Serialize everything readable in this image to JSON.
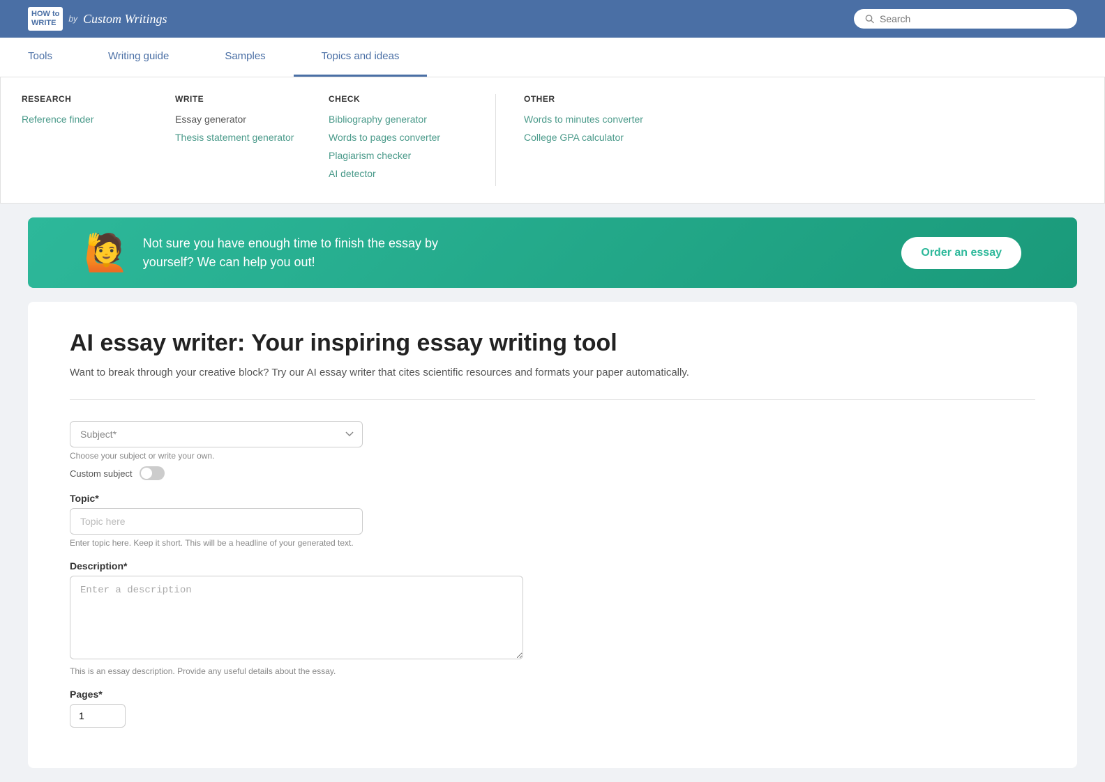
{
  "header": {
    "logo_line1": "HOW to",
    "logo_line2": "WRITE",
    "logo_by": "by",
    "logo_brand": "Custom Writings",
    "search_placeholder": "Search"
  },
  "nav": {
    "items": [
      {
        "id": "tools",
        "label": "Tools"
      },
      {
        "id": "writing-guide",
        "label": "Writing guide"
      },
      {
        "id": "samples",
        "label": "Samples"
      },
      {
        "id": "topics-ideas",
        "label": "Topics and ideas"
      }
    ]
  },
  "dropdown": {
    "research": {
      "title": "RESEARCH",
      "links": [
        {
          "label": "Reference finder",
          "href": "#"
        }
      ]
    },
    "write": {
      "title": "WRITE",
      "links": [
        {
          "label": "Essay generator",
          "href": "#"
        },
        {
          "label": "Thesis statement generator",
          "href": "#"
        }
      ]
    },
    "check": {
      "title": "CHECK",
      "links": [
        {
          "label": "Bibliography generator",
          "href": "#"
        },
        {
          "label": "Words to pages converter",
          "href": "#"
        },
        {
          "label": "Plagiarism checker",
          "href": "#"
        },
        {
          "label": "AI detector",
          "href": "#"
        }
      ]
    },
    "other": {
      "title": "OTHER",
      "links": [
        {
          "label": "Words to minutes converter",
          "href": "#"
        },
        {
          "label": "College GPA calculator",
          "href": "#"
        }
      ]
    }
  },
  "banner": {
    "emoji": "🙋",
    "text": "Not sure you have enough time to finish the essay by yourself? We can help you out!",
    "button_label": "Order an essay"
  },
  "main": {
    "title": "AI essay writer: Your inspiring essay writing tool",
    "subtitle": "Want to break through your creative block? Try our AI essay writer that cites scientific resources and formats your paper automatically.",
    "form": {
      "subject_placeholder": "Subject*",
      "subject_hint": "Choose your subject or write your own.",
      "custom_subject_label": "Custom subject",
      "topic_label": "Topic*",
      "topic_placeholder": "Topic here",
      "topic_hint": "Enter topic here. Keep it short. This will be a headline of your generated text.",
      "description_label": "Description*",
      "description_placeholder": "Enter a description",
      "description_hint": "This is an essay description. Provide any useful details about the essay.",
      "pages_label": "Pages*"
    }
  }
}
